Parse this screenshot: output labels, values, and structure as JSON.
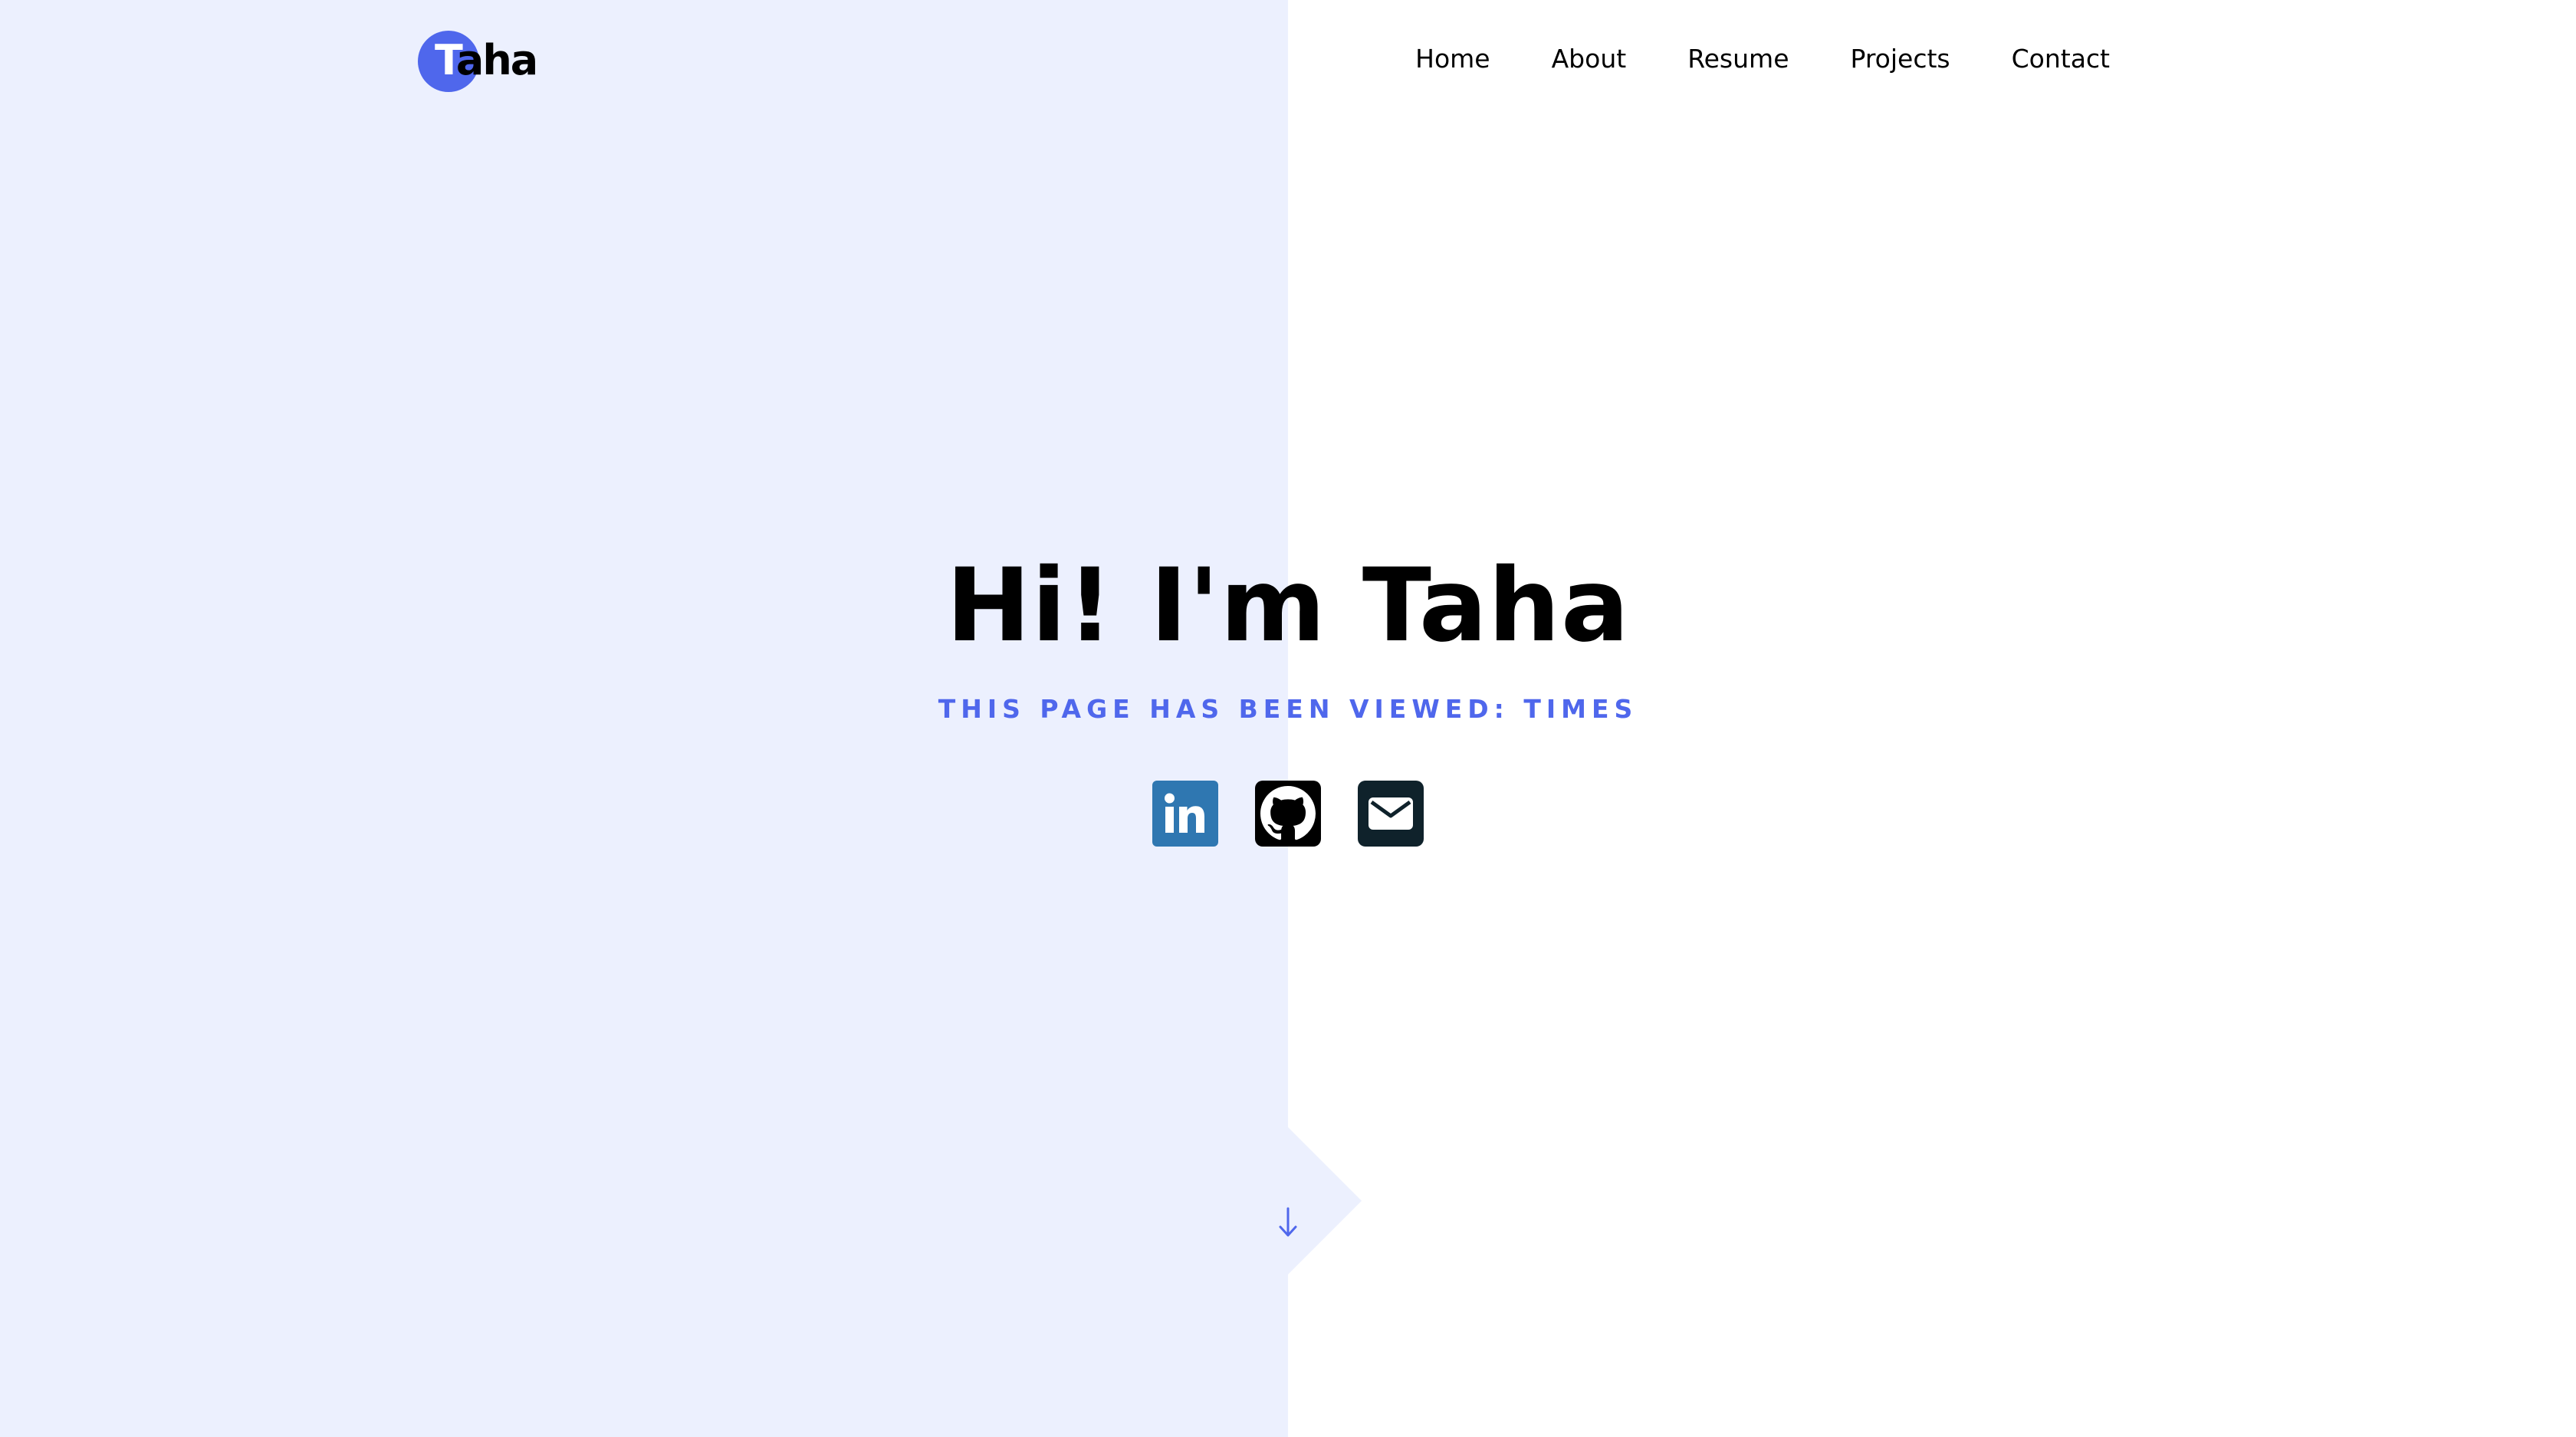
{
  "logo": {
    "first_letter": "T",
    "rest": "aha"
  },
  "nav": {
    "items": [
      {
        "label": "Home"
      },
      {
        "label": "About"
      },
      {
        "label": "Resume"
      },
      {
        "label": "Projects"
      },
      {
        "label": "Contact"
      }
    ]
  },
  "hero": {
    "title": "Hi! I'm Taha",
    "subtitle": "This page has been viewed: times"
  },
  "socials": [
    {
      "icon": "linkedin-icon"
    },
    {
      "icon": "github-icon"
    },
    {
      "icon": "email-icon"
    }
  ],
  "colors": {
    "accent": "#4f67ec",
    "panel": "#ecf0fe",
    "linkedin": "#2f77b1",
    "github": "#000000",
    "email": "#0f222b"
  },
  "scroll_icon": "arrow-down-icon"
}
